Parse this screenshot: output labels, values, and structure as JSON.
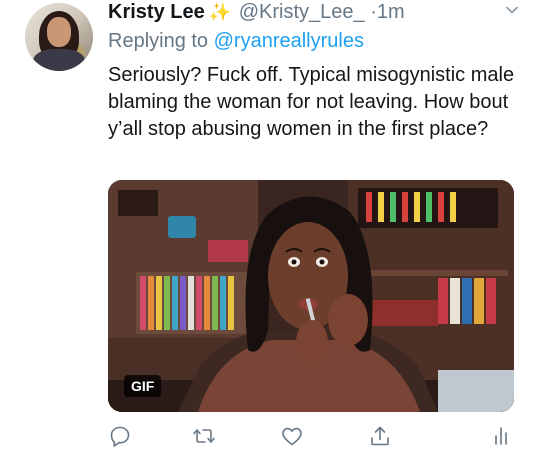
{
  "tweet": {
    "display_name": "Kristy Lee",
    "name_emoji": "✨",
    "handle": "@Kristy_Lee_",
    "separator": "·",
    "timestamp": "1m",
    "replying_prefix": "Replying to",
    "replying_to": "@ryanreallyrules",
    "text": "Seriously? Fuck off. Typical misogynistic male blaming the woman for not leaving. How bout y’all stop abusing women in the first place?",
    "media_badge": "GIF"
  },
  "icons": {
    "more": "chevron-down-icon",
    "reply": "reply-icon",
    "retweet": "retweet-icon",
    "like": "heart-icon",
    "share": "share-icon",
    "analytics": "analytics-icon"
  },
  "colors": {
    "handle_gray": "#657786",
    "mention_blue": "#1da1f2",
    "text": "#14171a"
  }
}
